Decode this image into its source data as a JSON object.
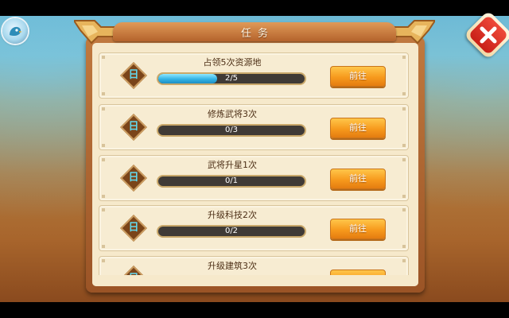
{
  "dialog": {
    "title": "任务"
  },
  "tasks": [
    {
      "badge": "日",
      "name": "占领5次资源地",
      "progress_text": "2/5",
      "progress": 0.4,
      "button_label": "前往"
    },
    {
      "badge": "日",
      "name": "修炼武将3次",
      "progress_text": "0/3",
      "progress": 0,
      "button_label": "前往"
    },
    {
      "badge": "日",
      "name": "武将升星1次",
      "progress_text": "0/1",
      "progress": 0,
      "button_label": "前往"
    },
    {
      "badge": "日",
      "name": "升级科技2次",
      "progress_text": "0/2",
      "progress": 0,
      "button_label": "前往"
    },
    {
      "badge": "日",
      "name": "升级建筑3次",
      "progress_text": "",
      "progress": 0,
      "button_label": ""
    }
  ],
  "icons": {
    "close": "close-icon",
    "avatar": "avatar-icon",
    "badge": "daily-badge-icon"
  },
  "colors": {
    "progress_fill": "#32b3e6",
    "button": "#f79a1d",
    "close": "#d82b20",
    "badge_text": "#63d7ec"
  }
}
